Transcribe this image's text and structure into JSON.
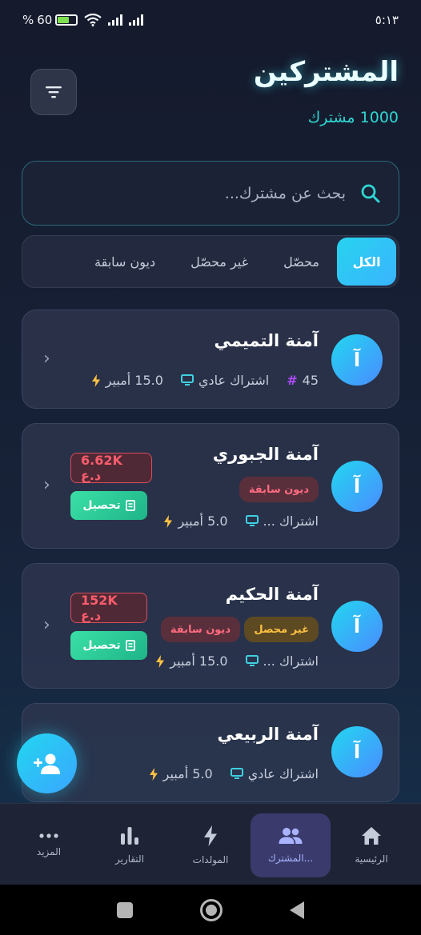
{
  "status_bar": {
    "time": "٥:١٣",
    "battery": "60",
    "battery_pct_sign": "%"
  },
  "header": {
    "title": "المشتركين",
    "subtitle": "1000 مشترك"
  },
  "search": {
    "placeholder": "بحث عن مشترك..."
  },
  "tabs": [
    {
      "label": "الكل",
      "active": true
    },
    {
      "label": "محصّل",
      "active": false
    },
    {
      "label": "غير محصّل",
      "active": false
    },
    {
      "label": "ديون سابقة",
      "active": false
    }
  ],
  "subscribers": [
    {
      "avatar_letter": "آ",
      "name": "آمنة التميمي",
      "amps": "15.0 أمبير",
      "plan": "اشتراك عادي",
      "number": "45"
    },
    {
      "avatar_letter": "آ",
      "name": "آمنة الجبوري",
      "badge_debt": "ديون سابقة",
      "amps": "5.0 أمبير",
      "plan": "اشتراك ...",
      "amount": "6.62K د.ع",
      "collect_label": "تحصيل"
    },
    {
      "avatar_letter": "آ",
      "name": "آمنة الحكيم",
      "badge_unpaid": "غير محصل",
      "badge_debt": "ديون سابقة",
      "amps": "15.0 أمبير",
      "plan": "اشتراك ...",
      "amount": "152K د.ع",
      "collect_label": "تحصيل"
    },
    {
      "avatar_letter": "آ",
      "name": "آمنة الربيعي",
      "amps": "5.0 أمبير",
      "plan": "اشتراك عادي"
    }
  ],
  "bottom_nav": [
    {
      "label": "الرئيسية",
      "icon": "home-icon",
      "active": false
    },
    {
      "label": "المشترك...",
      "icon": "users-icon",
      "active": true
    },
    {
      "label": "المولدات",
      "icon": "bolt-icon",
      "active": false
    },
    {
      "label": "التقارير",
      "icon": "bar-chart-icon",
      "active": false
    },
    {
      "label": "المزيد",
      "icon": "more-icon",
      "active": false
    }
  ],
  "colors": {
    "accent": "#27d3ee",
    "debt": "#ff6b7f",
    "unpaid": "#ffc242",
    "collect": "#2fcf98",
    "amps_icon": "#ffc242",
    "plan_icon": "#3fd0e0",
    "number_icon": "#b04cff"
  }
}
